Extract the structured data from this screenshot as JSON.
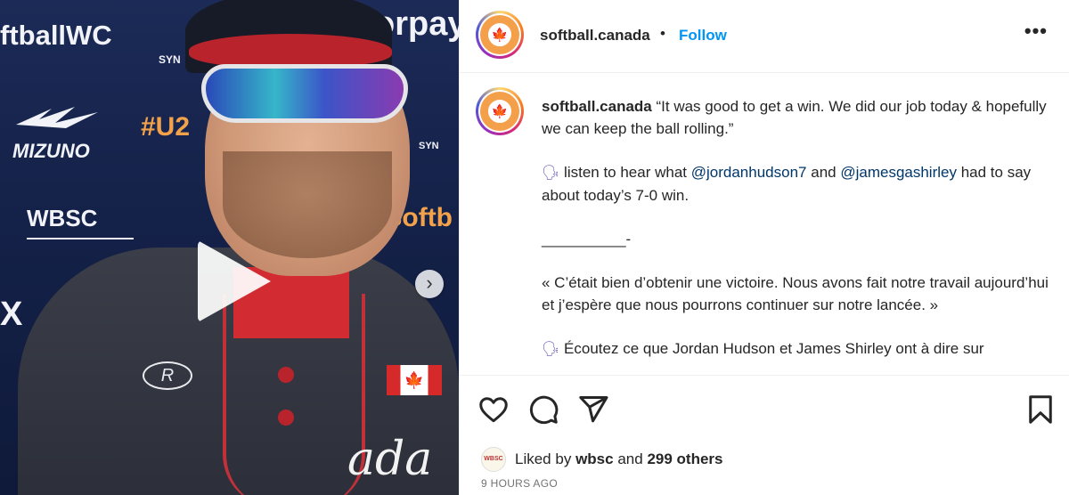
{
  "post": {
    "username": "softball.canada",
    "header_separator": "•",
    "follow_label": "Follow",
    "more_label": "•••",
    "avatar_logo_text": "🍁"
  },
  "media": {
    "sponsor_texts": {
      "wc": "ftballWC",
      "pay": "orpay",
      "syn1": "SYN",
      "mizuno": "MIZUNO",
      "u2": "#U2",
      "syn2": "SYN",
      "wbsc": "WBSC",
      "softb": "23Softb",
      "x": "X"
    },
    "jersey_mark": "R",
    "flag_mark": "🍁",
    "jersey_script": "ada",
    "next_icon": "›"
  },
  "caption": {
    "username": "softball.canada",
    "quote_en": "“It was good to get a win. We did our job today & hopefully we can keep the ball rolling.”",
    "emoji": "🗣",
    "listen_prefix": "listen to hear what",
    "mention_1": "@jordanhudson7",
    "and_word": "and",
    "mention_2": "@jamesgashirley",
    "listen_suffix": "had to say about today’s 7-0 win.",
    "divider": "__________-",
    "quote_fr": "« C’était bien d’obtenir une victoire. Nous avons fait notre travail aujourd’hui et j’espère que nous pourrons continuer sur notre lancée. »",
    "fr_partial": "Écoutez ce que Jordan Hudson et James Shirley ont à dire sur"
  },
  "likes": {
    "prefix": "Liked by",
    "user": "wbsc",
    "and_word": "and",
    "others": "299 others",
    "mini_avatar_text": "WBSC"
  },
  "timestamp": "9 HOURS AGO"
}
